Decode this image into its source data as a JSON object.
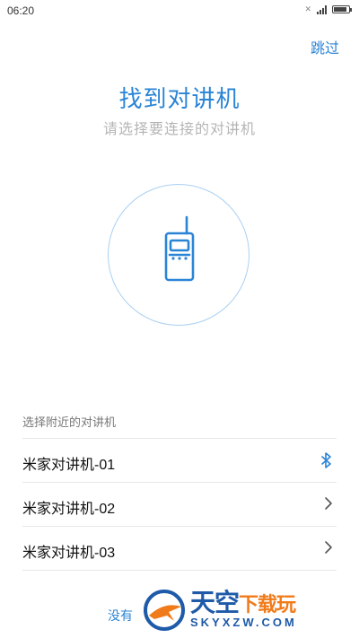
{
  "status_bar": {
    "time": "06:20",
    "sim_indicator": "✕",
    "battery_level": 0.85
  },
  "header": {
    "skip_label": "跳过"
  },
  "main": {
    "title": "找到对讲机",
    "subtitle": "请选择要连接的对讲机",
    "center_icon": "walkie-talkie-icon"
  },
  "nearby": {
    "section_label": "选择附近的对讲机",
    "items": [
      {
        "label": "米家对讲机-01",
        "icon": "bluetooth-icon"
      },
      {
        "label": "米家对讲机-02",
        "icon": "chevron-right-icon"
      },
      {
        "label": "米家对讲机-03",
        "icon": "chevron-right-icon"
      }
    ]
  },
  "footer": {
    "link_label": "没有"
  },
  "watermark": {
    "title_main": "天空",
    "title_accent": "下载玩",
    "subtitle": "SKYXZW.COM"
  },
  "colors": {
    "accent": "#2a84d6",
    "subtitle": "#b5b5b5",
    "circle": "#a9d0f2"
  }
}
